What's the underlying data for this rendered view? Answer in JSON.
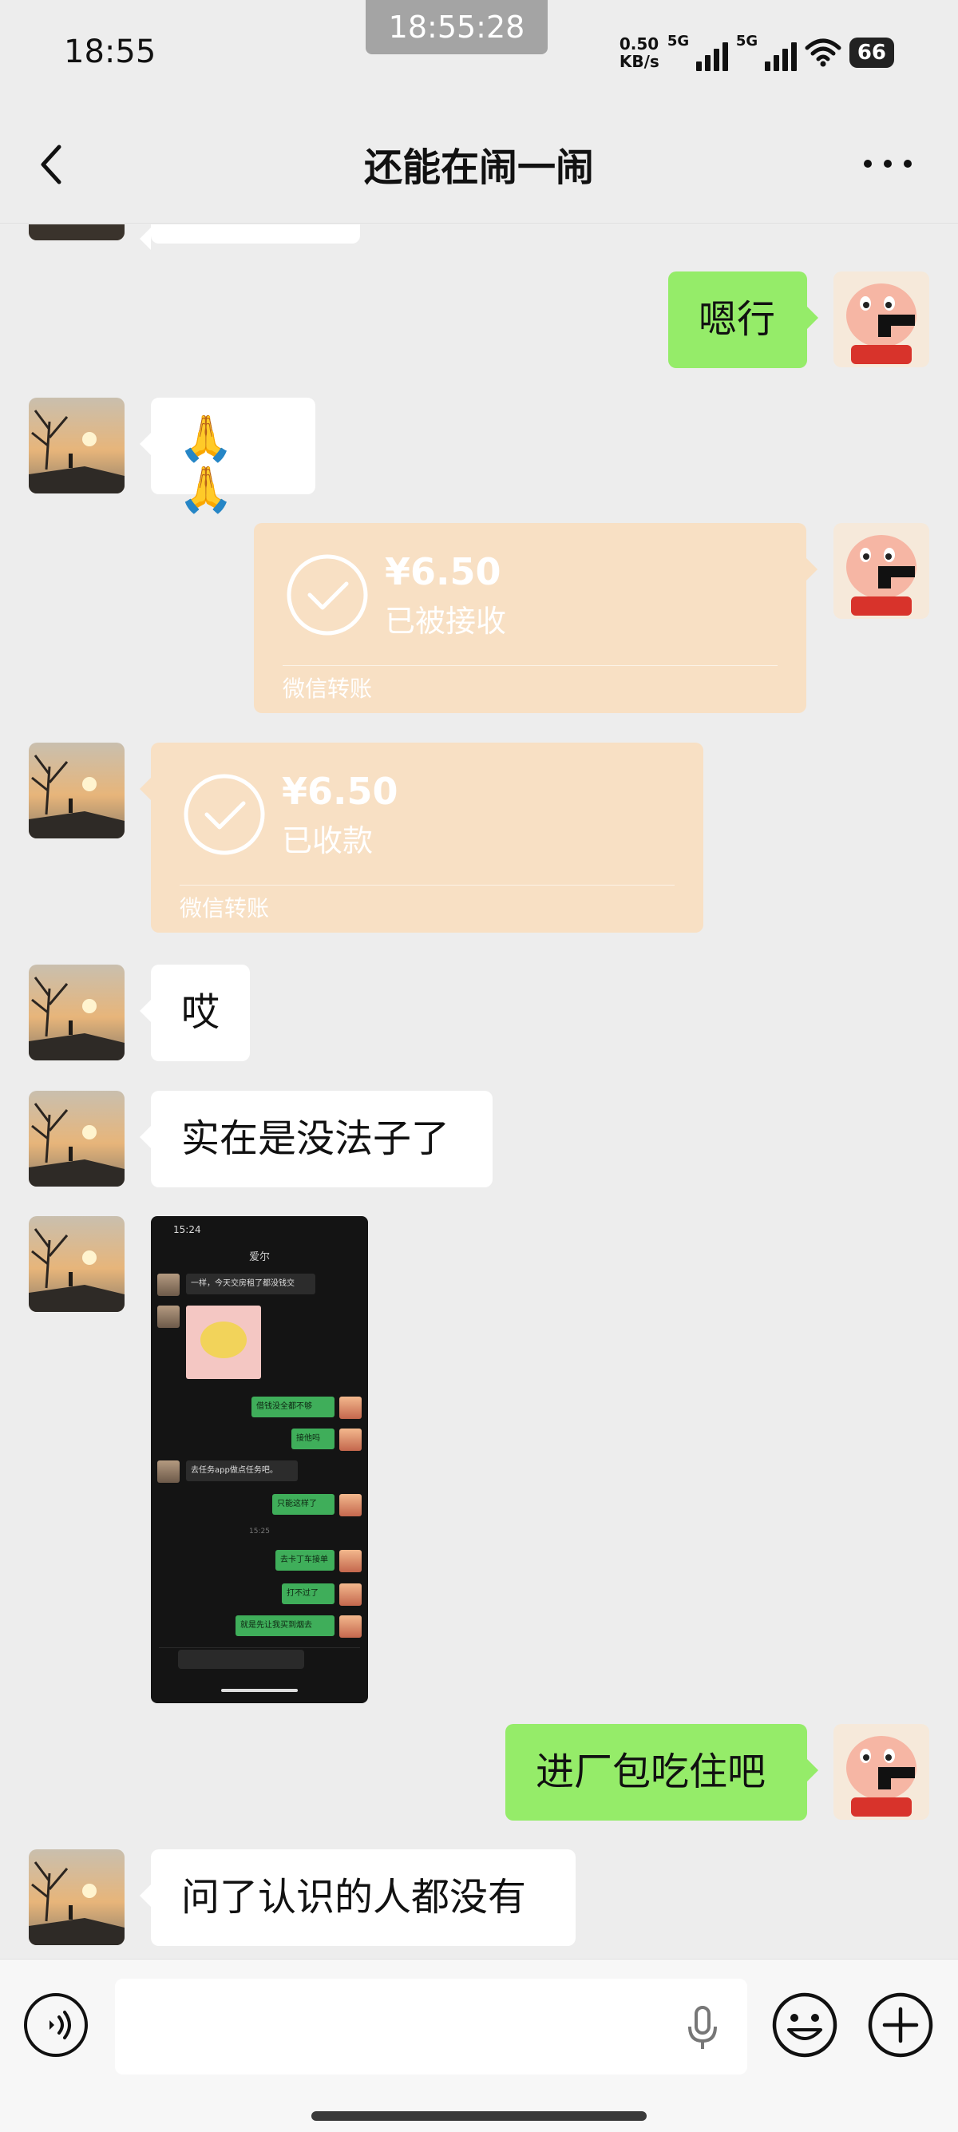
{
  "status_bar": {
    "time": "18:55",
    "center_time": "18:55:28",
    "net_speed_value": "0.50",
    "net_speed_unit": "KB/s",
    "net1": "5G",
    "net2": "5G",
    "battery": "66"
  },
  "nav": {
    "title": "还能在闹一闹",
    "back_icon": "chevron-left-icon",
    "more_icon": "more-dots-icon"
  },
  "messages": [
    {
      "side": "right",
      "type": "text",
      "text": "嗯行"
    },
    {
      "side": "left",
      "type": "text",
      "text": "🙏🙏"
    },
    {
      "side": "right",
      "type": "transfer",
      "amount": "¥6.50",
      "status": "已被接收",
      "footer": "微信转账"
    },
    {
      "side": "left",
      "type": "transfer",
      "amount": "¥6.50",
      "status": "已收款",
      "footer": "微信转账"
    },
    {
      "side": "left",
      "type": "text",
      "text": "哎"
    },
    {
      "side": "left",
      "type": "text",
      "text": "实在是没法子了"
    },
    {
      "side": "left",
      "type": "image",
      "text": ""
    },
    {
      "side": "right",
      "type": "text",
      "text": "进厂包吃住吧"
    },
    {
      "side": "left",
      "type": "text",
      "text": "问了认识的人都没有"
    }
  ],
  "screenshot": {
    "time": "15:24",
    "title": "爱尔",
    "lines": [
      "一样，今天交房租了都没钱交",
      "借钱没全都不够",
      "接他吗",
      "去任务app做点任务吧。",
      "只能这样了",
      "去卡丁车接单",
      "打不过了",
      "就是先让我买到烟去"
    ],
    "timestamp": "15:25"
  },
  "input_bar": {
    "voice_icon": "voice-icon",
    "mic_icon": "mic-icon",
    "emoji_icon": "emoji-icon",
    "plus_icon": "plus-icon"
  },
  "colors": {
    "background": "#ededed",
    "self_bubble": "#95ec69",
    "other_bubble": "#ffffff",
    "transfer_bubble": "#f8e0c4"
  }
}
